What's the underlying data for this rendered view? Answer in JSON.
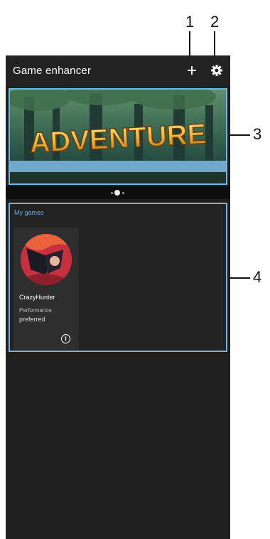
{
  "appbar": {
    "title": "Game enhancer",
    "add_icon": "plus-icon",
    "settings_icon": "gear-icon"
  },
  "banner": {
    "text": "ADVENTURE",
    "page_count": 3,
    "active_page": 2
  },
  "my_games": {
    "section_label": "My games",
    "items": [
      {
        "name": "CrazyHunter",
        "mode_line1": "Performance",
        "mode_line2": "preferred",
        "info_icon": "info-icon"
      }
    ]
  },
  "callouts": [
    "1",
    "2",
    "3",
    "4"
  ],
  "colors": {
    "background": "#1f1f1f",
    "highlight": "#6fb6e8",
    "accent_text": "#6aa8e0"
  }
}
